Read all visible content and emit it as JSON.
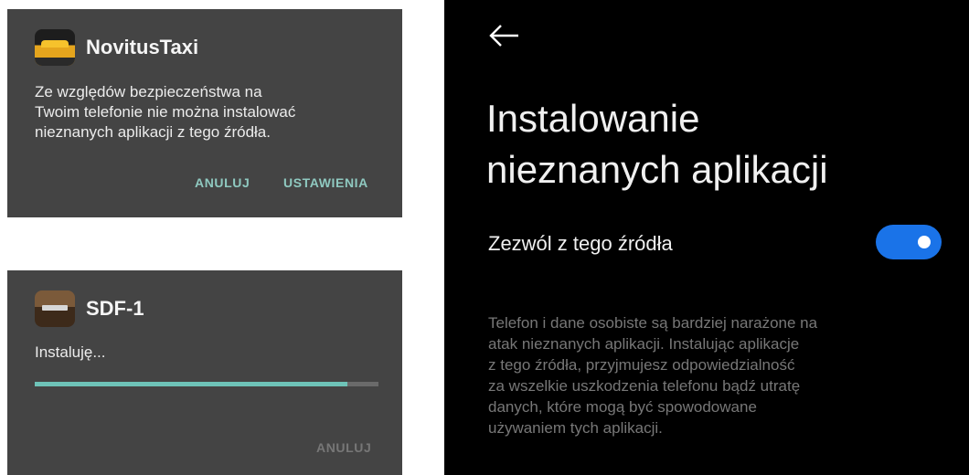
{
  "dialog_unknown_source": {
    "app_name": "NovitusTaxi",
    "message_lines": [
      "Ze względów bezpieczeństwa na",
      "Twoim telefonie nie można instalować",
      "nieznanych aplikacji z tego źródła."
    ],
    "cancel_label": "ANULUJ",
    "settings_label": "USTAWIENIA"
  },
  "dialog_installing": {
    "app_name": "SDF-1",
    "status": "Instaluję...",
    "progress": 0.91,
    "cancel_label": "ANULUJ"
  },
  "settings_screen": {
    "title_lines": [
      "Instalowanie",
      "nieznanych aplikacji"
    ],
    "toggle_label": "Zezwól z tego źródła",
    "toggle_on": true,
    "warning_lines": [
      "Telefon i dane osobiste są bardziej narażone na",
      "atak nieznanych aplikacji. Instalując aplikacje",
      "z tego źródła, przyjmujesz odpowiedzialność",
      "za wszelkie uszkodzenia telefonu bądź utratę",
      "danych, które mogą być spowodowane",
      "używaniem tych aplikacji."
    ]
  },
  "colors": {
    "dialog_bg": "#444444",
    "dialog_button": "#8fc9c0",
    "progress_fill": "#6ec3b8",
    "toggle_on": "#1a73e8",
    "screen_bg": "#000000"
  },
  "icons": {
    "novitus": "taxi-app-icon",
    "sdf": "sdf-app-icon",
    "back": "back-arrow-icon"
  }
}
